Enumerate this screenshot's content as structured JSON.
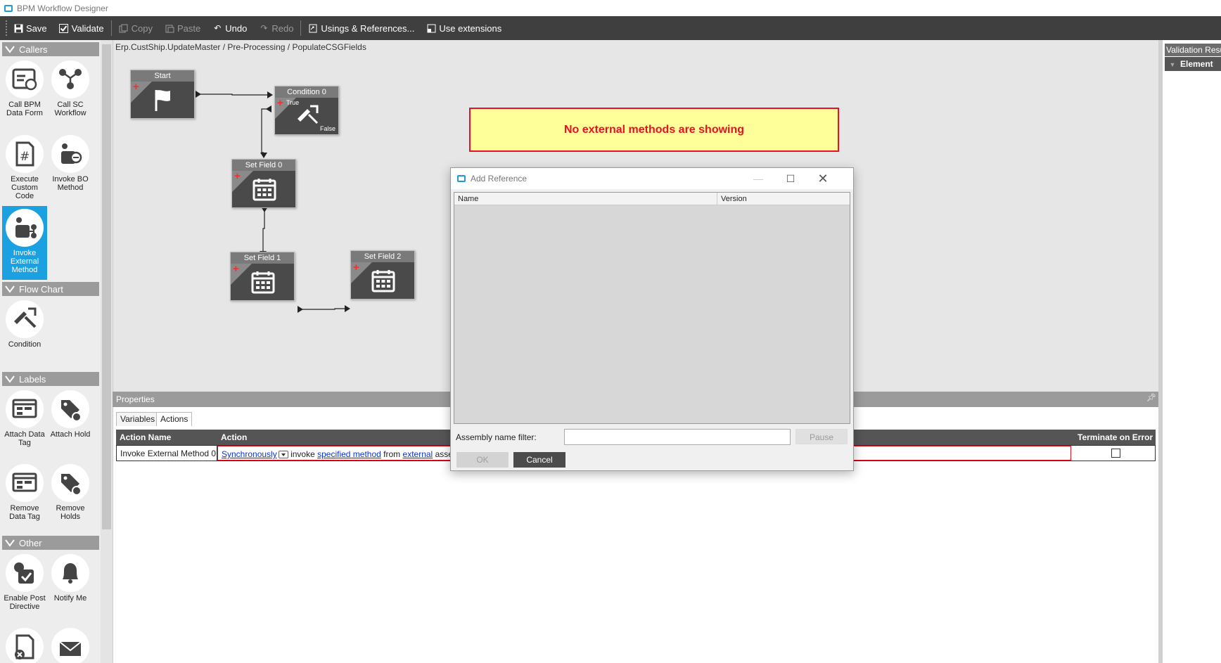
{
  "window": {
    "title": "BPM Workflow Designer"
  },
  "toolbar": {
    "save": "Save",
    "validate": "Validate",
    "copy": "Copy",
    "paste": "Paste",
    "undo": "Undo",
    "redo": "Redo",
    "usings": "Usings & References...",
    "extensions": "Use extensions"
  },
  "palette": {
    "callers": {
      "header": "Callers",
      "items": [
        "Call BPM Data Form",
        "Call SC Workflow",
        "Execute Custom Code",
        "Invoke BO Method",
        "Invoke External Method"
      ]
    },
    "flowchart": {
      "header": "Flow Chart",
      "items": [
        "Condition"
      ]
    },
    "labels": {
      "header": "Labels",
      "items": [
        "Attach Data Tag",
        "Attach Hold",
        "Remove Data Tag",
        "Remove Holds"
      ]
    },
    "other": {
      "header": "Other",
      "items": [
        "Enable Post Directive",
        "Notify Me"
      ]
    }
  },
  "canvas": {
    "breadcrumb": "Erp.CustShip.UpdateMaster / Pre-Processing / PopulateCSGFields",
    "nodes": {
      "start": "Start",
      "condition": "Condition 0",
      "condition_true": "True",
      "condition_false": "False",
      "setfield0": "Set Field 0",
      "setfield1": "Set Field 1",
      "setfield2": "Set Field 2"
    },
    "warning": "No external methods are showing"
  },
  "validation": {
    "title": "Validation Results",
    "column": "Element"
  },
  "properties": {
    "title": "Properties",
    "tabs": [
      "Variables",
      "Actions"
    ],
    "selected_tab": "Actions",
    "columns": [
      "Action Name",
      "Action",
      "Terminate on Error"
    ],
    "row": {
      "name": "Invoke External Method 0",
      "sync": "Synchronously",
      "invoke": "invoke",
      "method": "specified method",
      "from": "from",
      "external": "external",
      "tail": "assembly",
      "terminate": false
    }
  },
  "dialog": {
    "title": "Add Reference",
    "columns": [
      "Name",
      "Version"
    ],
    "filter_label": "Assembly name filter:",
    "filter_value": "",
    "pause": "Pause",
    "ok": "OK",
    "cancel": "Cancel"
  },
  "colors": {
    "accent": "#1ba1e2",
    "toolbar": "#3f3f3f",
    "warning_bg": "#ffff99",
    "warning_fg": "#e81123",
    "node_bg": "#4a4a4a"
  }
}
